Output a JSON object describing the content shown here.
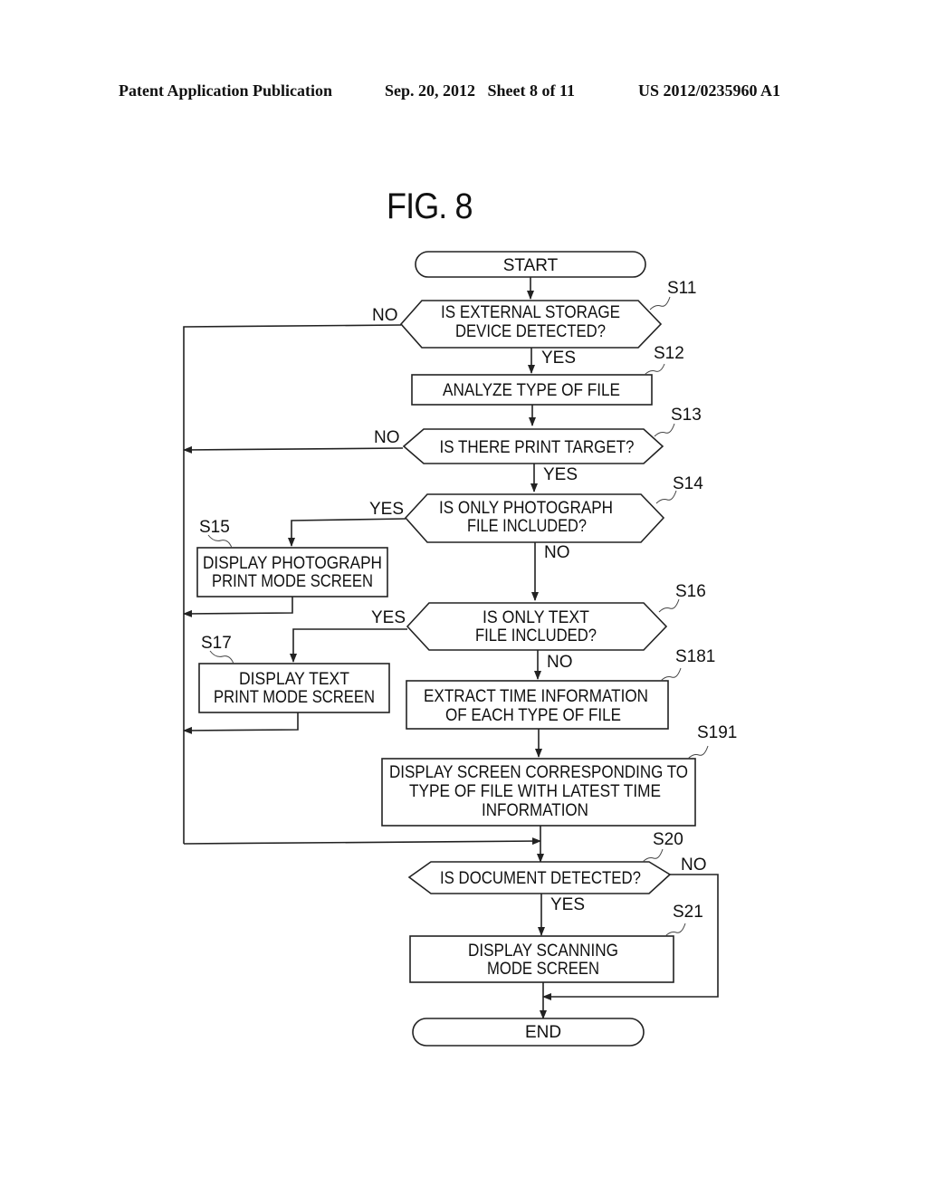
{
  "header": {
    "publication": "Patent Application Publication",
    "date_sheet": "Sep. 20, 2012   Sheet 8 of 11",
    "patent_number": "US 2012/0235960 A1"
  },
  "figure": {
    "title": "FIG. 8"
  },
  "flowchart": {
    "start": "START",
    "end": "END",
    "steps": {
      "s11": {
        "id": "S11",
        "type": "decision",
        "lines": [
          "IS EXTERNAL STORAGE",
          "DEVICE DETECTED?"
        ]
      },
      "s12": {
        "id": "S12",
        "type": "process",
        "lines": [
          "ANALYZE TYPE OF FILE"
        ]
      },
      "s13": {
        "id": "S13",
        "type": "decision",
        "lines": [
          "IS THERE PRINT TARGET?"
        ]
      },
      "s14": {
        "id": "S14",
        "type": "decision",
        "lines": [
          "IS ONLY PHOTOGRAPH",
          "FILE INCLUDED?"
        ]
      },
      "s15": {
        "id": "S15",
        "type": "process",
        "lines": [
          "DISPLAY PHOTOGRAPH",
          "PRINT MODE SCREEN"
        ]
      },
      "s16": {
        "id": "S16",
        "type": "decision",
        "lines": [
          "IS ONLY TEXT",
          "FILE INCLUDED?"
        ]
      },
      "s17": {
        "id": "S17",
        "type": "process",
        "lines": [
          "DISPLAY TEXT",
          "PRINT MODE SCREEN"
        ]
      },
      "s181": {
        "id": "S181",
        "type": "process",
        "lines": [
          "EXTRACT TIME INFORMATION",
          "OF EACH TYPE OF FILE"
        ]
      },
      "s191": {
        "id": "S191",
        "type": "process",
        "lines": [
          "DISPLAY SCREEN CORRESPONDING TO",
          "TYPE OF FILE WITH LATEST TIME",
          "INFORMATION"
        ]
      },
      "s20": {
        "id": "S20",
        "type": "decision",
        "lines": [
          "IS DOCUMENT DETECTED?"
        ]
      },
      "s21": {
        "id": "S21",
        "type": "process",
        "lines": [
          "DISPLAY SCANNING",
          "MODE SCREEN"
        ]
      }
    },
    "branch_labels": {
      "s11_no": "NO",
      "s11_yes": "YES",
      "s13_no": "NO",
      "s13_yes": "YES",
      "s14_yes": "YES",
      "s14_no": "NO",
      "s16_yes": "YES",
      "s16_no": "NO",
      "s20_no": "NO",
      "s20_yes": "YES"
    }
  }
}
